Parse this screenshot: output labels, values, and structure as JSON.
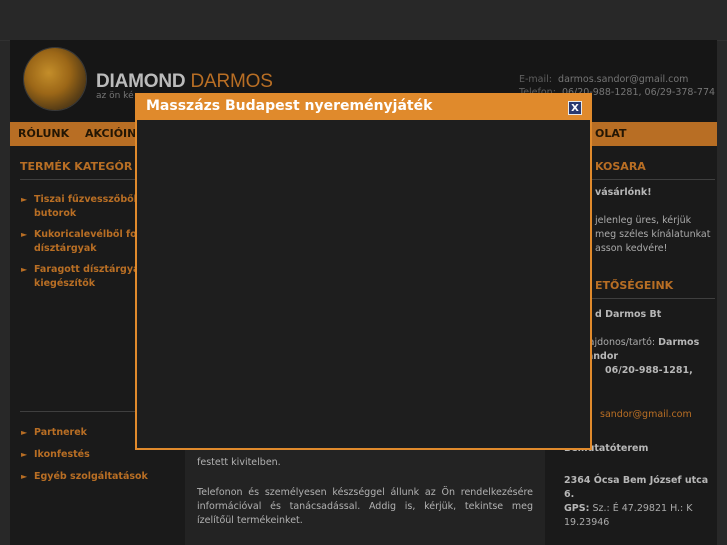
{
  "site": {
    "logo_word1": "DIAMOND",
    "logo_word2": "DARMOS",
    "tagline": "az ön ké"
  },
  "contact": {
    "email_label": "E-mail:",
    "email_value": "darmos.sandor@gmail.com",
    "phone_label": "Telefon:",
    "phone_value": "06/20-988-1281, 06/29-378-774"
  },
  "nav": {
    "items": [
      "RÓLUNK",
      "AKCIÓIN",
      "OLAT"
    ]
  },
  "left": {
    "categories_title": "TERMÉK KATEGÓR",
    "categories": [
      "Tiszai fűzvesszőből k butorok",
      "Kukoricalevélből fon dísztárgyak",
      "Faragott dísztárgyak kiegészítők"
    ],
    "links": [
      "Partnerek",
      "Ikonfestés",
      "Egyéb szolgáltatások"
    ]
  },
  "main": {
    "para1": "festett kivitelben.",
    "para2": "Telefonon és személyesen készséggel állunk az Ön rendelkezésére információval és tanácsadással. Addig is, kérjük, tekintse meg ízelítőül termékeinket."
  },
  "right": {
    "cart_title": "KOSARA",
    "cart_greeting": "vásárlónk!",
    "cart_text": "jelenleg üres, kérjük meg széles kínálatunkat asson kedvére!",
    "contact_title": "ETŐSÉGEINK",
    "company": "d Darmos Bt",
    "owner_label": "ulajdonos/tartó:",
    "owner": "Darmos Sándor",
    "phone": "06/20-988-1281,",
    "email": "sandor@gmail.com",
    "showroom": "Bemutatóterem",
    "address": "2364 Ócsa Bem József utca 6.",
    "gps_label": "GPS:",
    "gps_value": "Sz.: É 47.29821 H.: K 19.23946"
  },
  "modal": {
    "title": "Masszázs Budapest nyereményjáték",
    "close_symbol": "X"
  },
  "colors": {
    "accent": "#d9822b",
    "modal_border": "#e08a2c",
    "background": "#1c1c1c"
  }
}
